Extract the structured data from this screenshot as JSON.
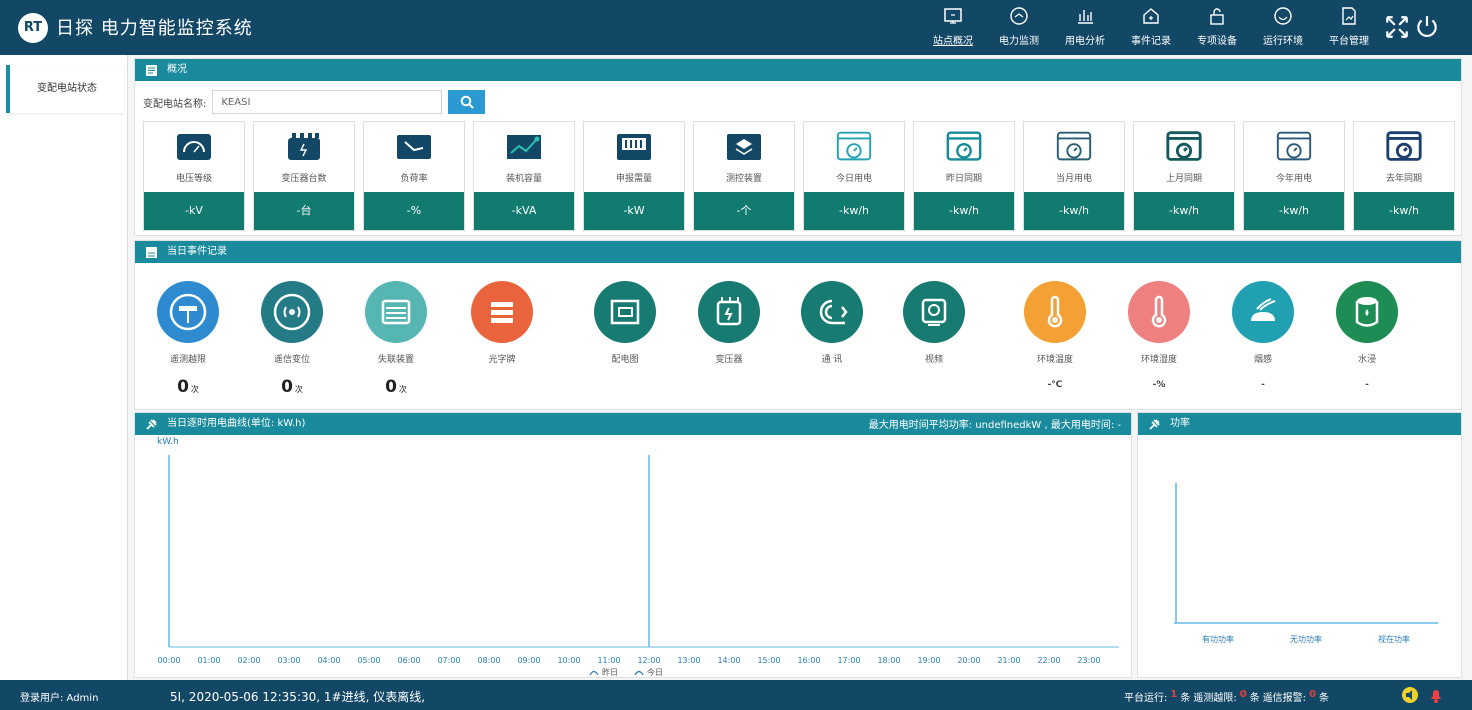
{
  "brand": {
    "logo": "RT",
    "name": "日探 电力智能监控系统"
  },
  "nav": [
    {
      "label": "站点概况",
      "icon": "monitor-icon",
      "active": true
    },
    {
      "label": "电力监测",
      "icon": "gauge-icon"
    },
    {
      "label": "用电分析",
      "icon": "bar-chart-icon"
    },
    {
      "label": "事件记录",
      "icon": "home-icon"
    },
    {
      "label": "专项设备",
      "icon": "lock-icon"
    },
    {
      "label": "运行环境",
      "icon": "circle-icon"
    },
    {
      "label": "平台管理",
      "icon": "document-icon"
    }
  ],
  "sidebar": {
    "items": [
      {
        "label": "变配电站状态"
      }
    ]
  },
  "overview": {
    "title": "概况",
    "search_label": "变配电站名称:",
    "search_value": "KEASI",
    "cards": [
      {
        "label": "电压等级",
        "value": "-kV",
        "icon": "gauge-icon"
      },
      {
        "label": "变压器台数",
        "value": "-台",
        "icon": "transformer-icon"
      },
      {
        "label": "负荷率",
        "value": "-%",
        "icon": "meter-icon"
      },
      {
        "label": "装机容量",
        "value": "-kVA",
        "icon": "line-chart-icon"
      },
      {
        "label": "申报需量",
        "value": "-kW",
        "icon": "panel-icon"
      },
      {
        "label": "测控装置",
        "value": "-个",
        "icon": "stack-icon"
      },
      {
        "label": "今日用电",
        "value": "-kw/h",
        "icon": "window-timer-icon"
      },
      {
        "label": "昨日同期",
        "value": "-kw/h",
        "icon": "window-timer-icon"
      },
      {
        "label": "当月用电",
        "value": "-kw/h",
        "icon": "window-timer-icon"
      },
      {
        "label": "上月同期",
        "value": "-kw/h",
        "icon": "window-timer-icon"
      },
      {
        "label": "今年用电",
        "value": "-kw/h",
        "icon": "window-timer-icon"
      },
      {
        "label": "去年同期",
        "value": "-kw/h",
        "icon": "window-timer-icon"
      }
    ]
  },
  "events": {
    "title": "当日事件记录",
    "items": [
      {
        "label": "遥测越限",
        "value": "0",
        "unit": "次",
        "color": "#2e8bd0"
      },
      {
        "label": "遥信变位",
        "value": "0",
        "unit": "次",
        "color": "#247b86"
      },
      {
        "label": "失联装置",
        "value": "0",
        "unit": "次",
        "color": "#56b6b2"
      },
      {
        "label": "光字牌",
        "value": "",
        "unit": "",
        "color": "#e9633c"
      },
      {
        "label": "配电图",
        "value": "",
        "unit": "",
        "color": "#187b72"
      },
      {
        "label": "变压器",
        "value": "",
        "unit": "",
        "color": "#187b72"
      },
      {
        "label": "通 讯",
        "value": "",
        "unit": "",
        "color": "#187b72"
      },
      {
        "label": "视频",
        "value": "",
        "unit": "",
        "color": "#187b72"
      },
      {
        "label": "环境温度",
        "value": "-℃",
        "unit": "",
        "color": "#f3a034"
      },
      {
        "label": "环境湿度",
        "value": "-%",
        "unit": "",
        "color": "#ef8080"
      },
      {
        "label": "烟感",
        "value": "-",
        "unit": "",
        "color": "#20a0b0"
      },
      {
        "label": "水浸",
        "value": "-",
        "unit": "",
        "color": "#1d8d55"
      }
    ]
  },
  "curve": {
    "title": "当日逐时用电曲线(单位: kW.h)",
    "right_text": "最大用电时间平均功率: undefinedkW , 最大用电时间: -",
    "unit": "kW.h",
    "legend": [
      "昨日",
      "今日"
    ]
  },
  "power": {
    "title": "功率"
  },
  "chart_data": [
    {
      "type": "line",
      "title": "当日逐时用电曲线(单位: kW.h)",
      "ylabel": "kW.h",
      "x": [
        "00:00",
        "01:00",
        "02:00",
        "03:00",
        "04:00",
        "05:00",
        "06:00",
        "07:00",
        "08:00",
        "09:00",
        "10:00",
        "11:00",
        "12:00",
        "13:00",
        "14:00",
        "15:00",
        "16:00",
        "17:00",
        "18:00",
        "19:00",
        "20:00",
        "21:00",
        "22:00",
        "23:00"
      ],
      "series": [
        {
          "name": "昨日",
          "values": []
        },
        {
          "name": "今日",
          "values": []
        }
      ]
    },
    {
      "type": "bar",
      "title": "功率",
      "categories": [
        "有功功率",
        "无功功率",
        "视在功率"
      ],
      "values": []
    }
  ],
  "statusbar": {
    "user": "登录用户: Admin",
    "message": "5I, 2020-05-06 12:35:30, 1#进线, 仪表离线,",
    "platform": "平台运行:",
    "platform_count": "1",
    "count_unit_a": "条",
    "telemetry_label": "遥测越限:",
    "telemetry_count": "0",
    "count_unit_b": "条",
    "signal_label": "遥信报警:",
    "signal_count": "0",
    "count_unit_c": "条"
  }
}
